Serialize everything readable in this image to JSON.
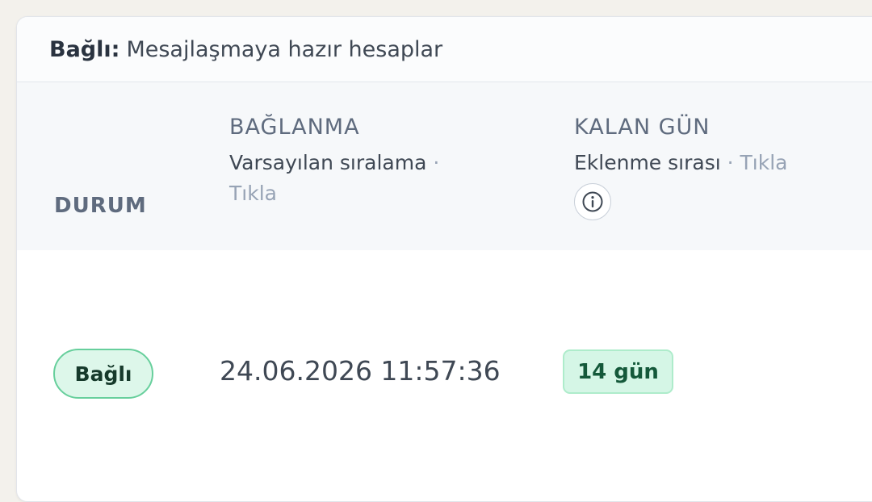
{
  "header": {
    "label_strong": "Bağlı:",
    "label_text": "Mesajlaşmaya hazır hesaplar"
  },
  "columns": {
    "status": {
      "label": "DURUM"
    },
    "connection": {
      "label": "BAĞLANMA",
      "sort_text": "Varsayılan sıralama",
      "separator": "·",
      "click_text": "Tıkla"
    },
    "remaining": {
      "label": "KALAN GÜN",
      "sort_text": "Eklenme sırası",
      "separator": "·",
      "click_text": "Tıkla",
      "info_icon": "info-icon"
    }
  },
  "rows": [
    {
      "status": "Bağlı",
      "connected_at": "24.06.2026 11:57:36",
      "remaining_days": "14 gün"
    }
  ],
  "colors": {
    "connected_pill_bg": "#ddf7ea",
    "connected_pill_border": "#67cf9c",
    "days_badge_bg": "#d5f6e6",
    "days_badge_text": "#14593a",
    "muted_text": "#97a3b5"
  }
}
